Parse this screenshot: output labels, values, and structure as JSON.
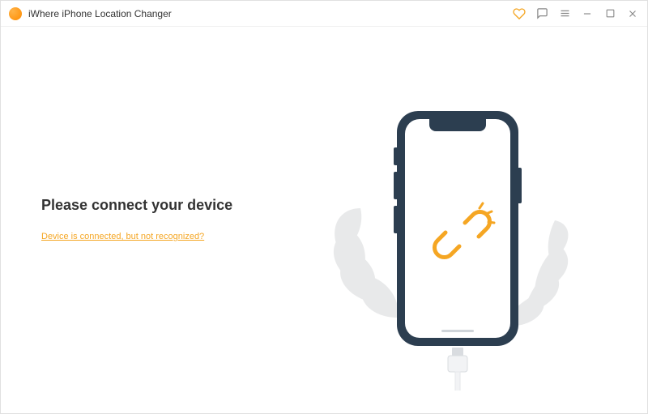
{
  "titlebar": {
    "app_title": "iWhere iPhone Location Changer"
  },
  "main": {
    "heading": "Please connect your device",
    "help_link": "Device is connected, but not recognized?"
  },
  "icons": {
    "heart": "heart-icon",
    "feedback": "feedback-icon",
    "menu": "menu-icon",
    "minimize": "minimize-icon",
    "maximize": "maximize-icon",
    "close": "close-icon"
  },
  "colors": {
    "accent": "#f5a623",
    "text": "#333333",
    "phone_frame": "#2c3e50",
    "leaf_bg": "#e8e9ea"
  }
}
